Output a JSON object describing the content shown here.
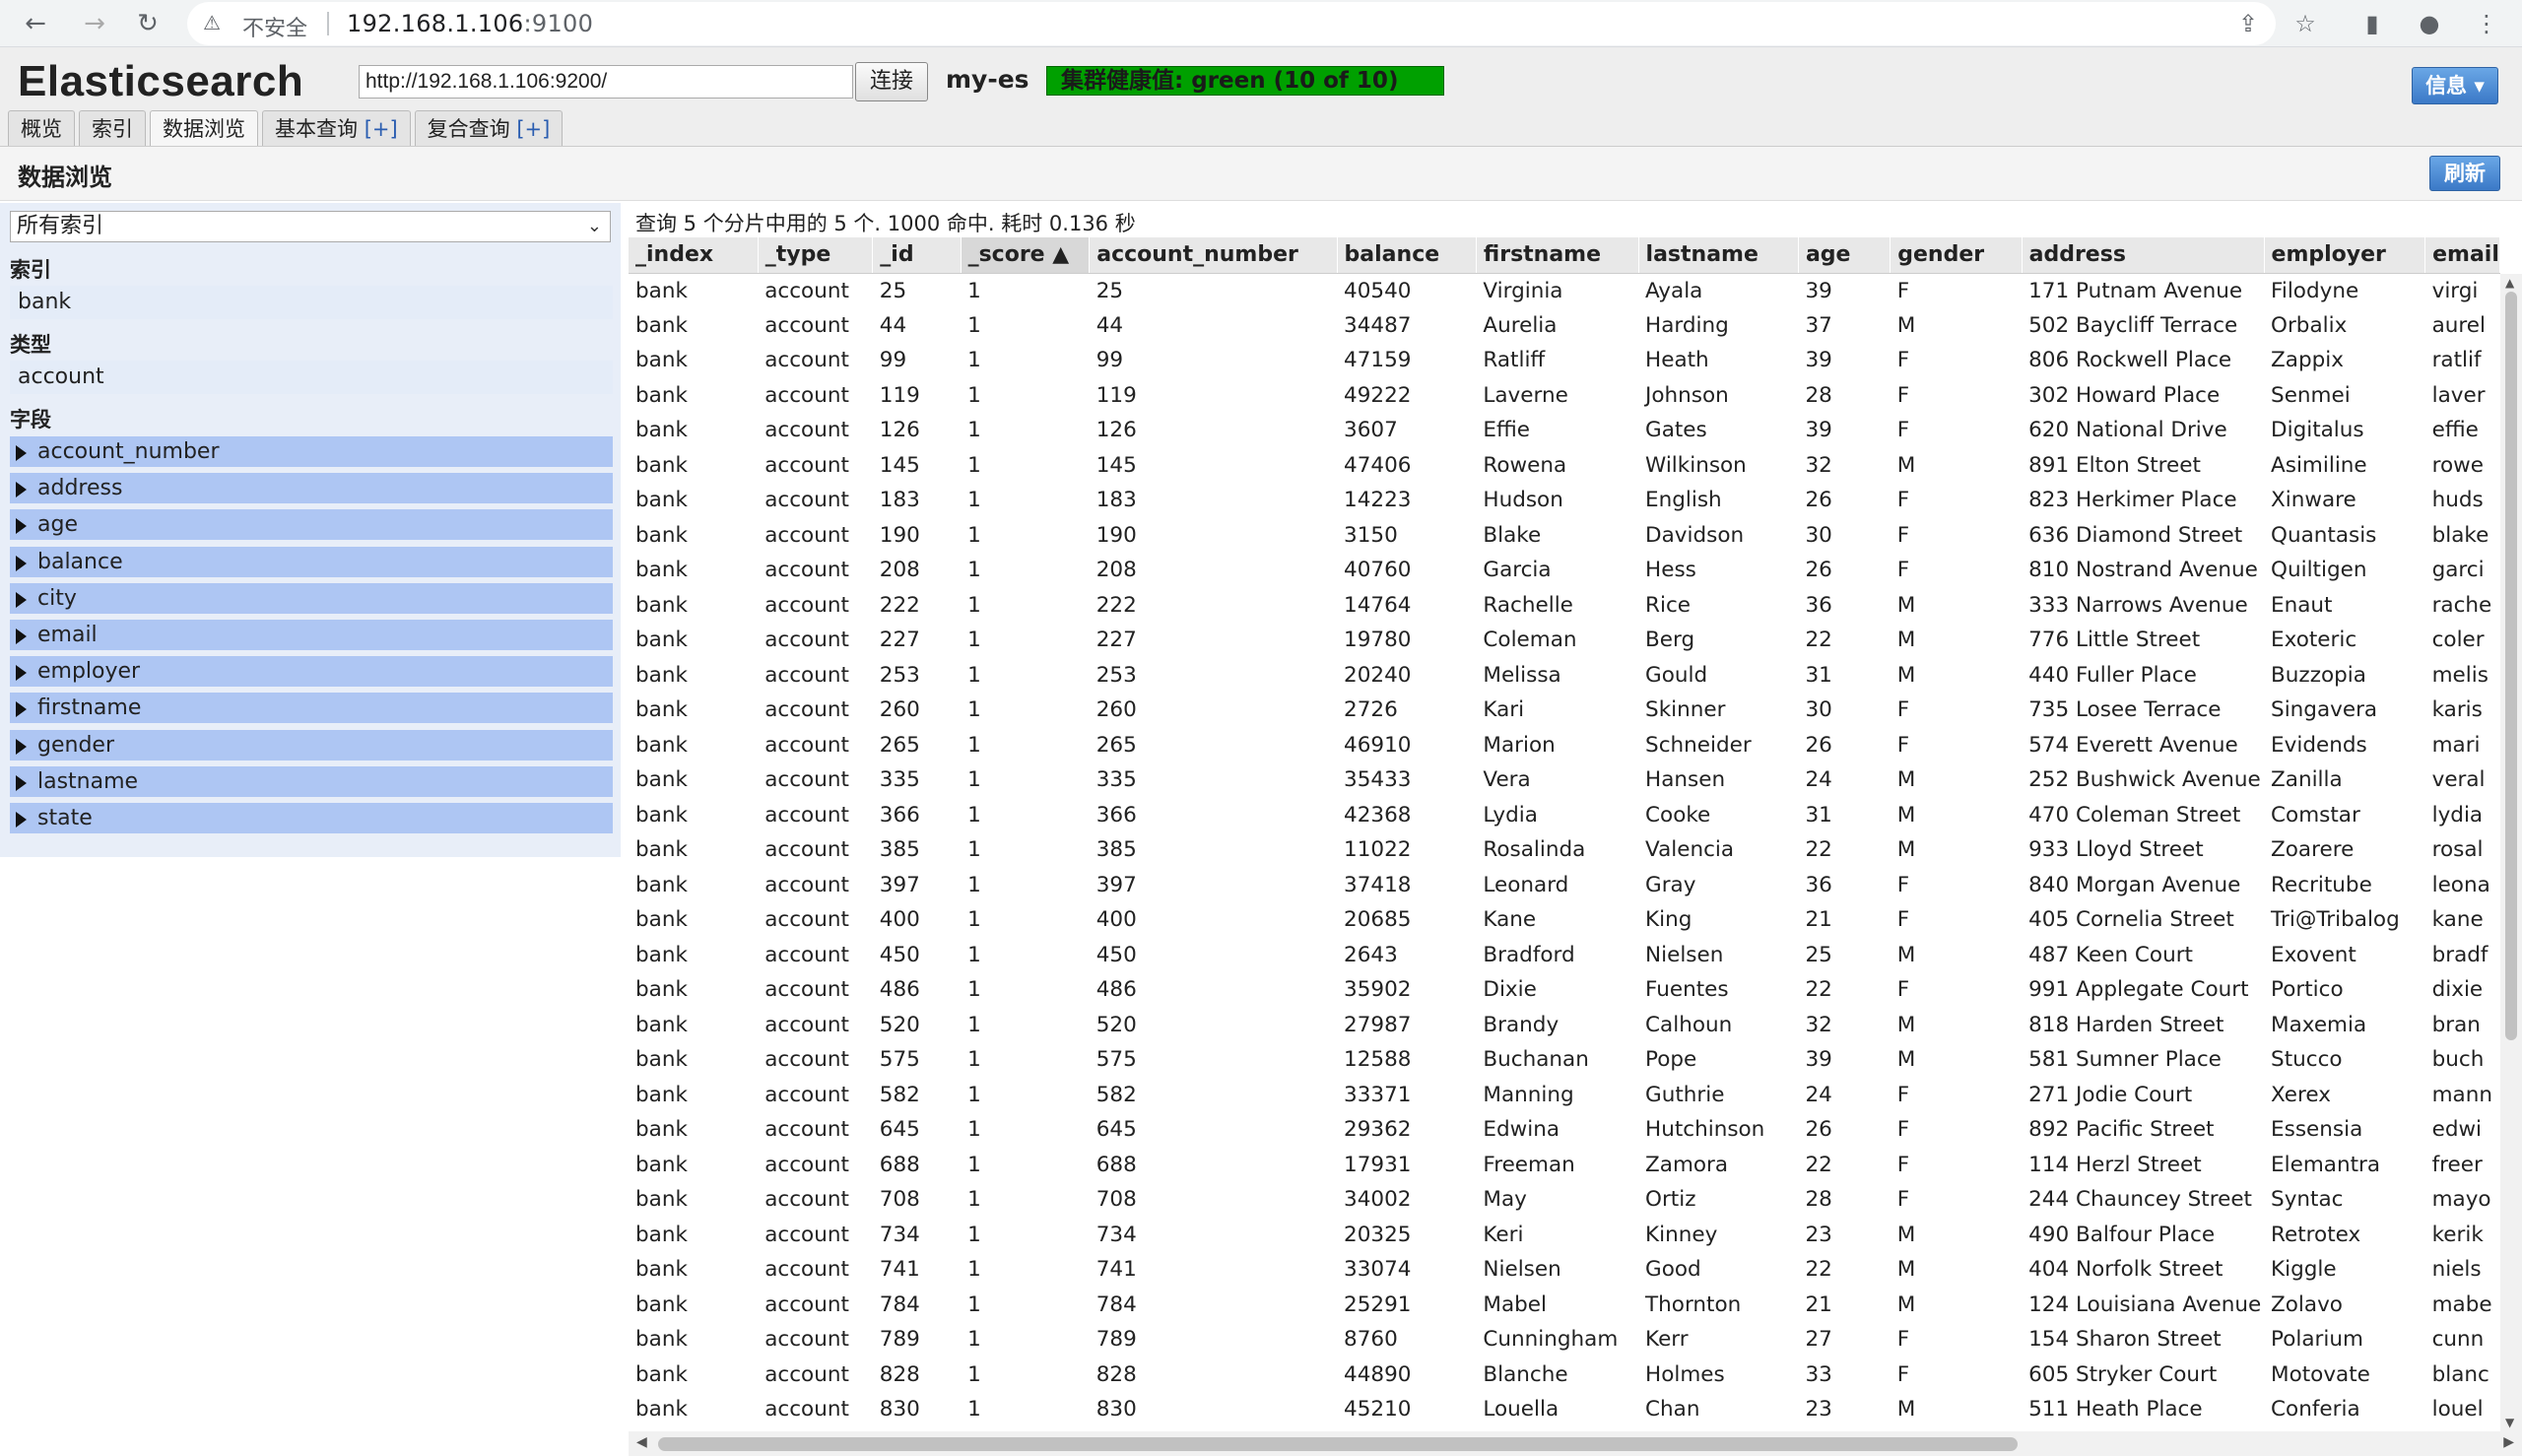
{
  "browser": {
    "warning_icon": "warning-triangle-icon",
    "insecure_label": "不安全",
    "url_host": "192.168.1.106",
    "url_port": ":9100"
  },
  "app": {
    "title": "Elasticsearch",
    "es_url": "http://192.168.1.106:9200/",
    "connect_label": "连接",
    "cluster_name": "my-es",
    "health_text": "集群健康值: green (10 of 10)",
    "info_label": "信息 ▾",
    "health_color": "#00a000"
  },
  "tabs": [
    {
      "label": "概览"
    },
    {
      "label": "索引"
    },
    {
      "label": "数据浏览"
    },
    {
      "label": "基本查询 ",
      "plus": "[+]"
    },
    {
      "label": "复合查询 ",
      "plus": "[+]"
    }
  ],
  "subheader": {
    "title": "数据浏览",
    "refresh_label": "刷新"
  },
  "sidebar": {
    "index_select_value": "所有索引",
    "index_label": "索引",
    "index_item": "bank",
    "type_label": "类型",
    "type_item": "account",
    "field_label": "字段",
    "fields": [
      "account_number",
      "address",
      "age",
      "balance",
      "city",
      "email",
      "employer",
      "firstname",
      "gender",
      "lastname",
      "state"
    ]
  },
  "results": {
    "summary": "查询 5 个分片中用的 5 个. 1000 命中. 耗时 0.136 秒",
    "columns": [
      "_index",
      "_type",
      "_id",
      "_score ▲",
      "account_number",
      "balance",
      "firstname",
      "lastname",
      "age",
      "gender",
      "address",
      "employer",
      "email"
    ],
    "rows": [
      [
        "bank",
        "account",
        "25",
        "1",
        "25",
        "40540",
        "Virginia",
        "Ayala",
        "39",
        "F",
        "171 Putnam Avenue",
        "Filodyne",
        "virgi"
      ],
      [
        "bank",
        "account",
        "44",
        "1",
        "44",
        "34487",
        "Aurelia",
        "Harding",
        "37",
        "M",
        "502 Baycliff Terrace",
        "Orbalix",
        "aurel"
      ],
      [
        "bank",
        "account",
        "99",
        "1",
        "99",
        "47159",
        "Ratliff",
        "Heath",
        "39",
        "F",
        "806 Rockwell Place",
        "Zappix",
        "ratlif"
      ],
      [
        "bank",
        "account",
        "119",
        "1",
        "119",
        "49222",
        "Laverne",
        "Johnson",
        "28",
        "F",
        "302 Howard Place",
        "Senmei",
        "laver"
      ],
      [
        "bank",
        "account",
        "126",
        "1",
        "126",
        "3607",
        "Effie",
        "Gates",
        "39",
        "F",
        "620 National Drive",
        "Digitalus",
        "effie"
      ],
      [
        "bank",
        "account",
        "145",
        "1",
        "145",
        "47406",
        "Rowena",
        "Wilkinson",
        "32",
        "M",
        "891 Elton Street",
        "Asimiline",
        "rowe"
      ],
      [
        "bank",
        "account",
        "183",
        "1",
        "183",
        "14223",
        "Hudson",
        "English",
        "26",
        "F",
        "823 Herkimer Place",
        "Xinware",
        "huds"
      ],
      [
        "bank",
        "account",
        "190",
        "1",
        "190",
        "3150",
        "Blake",
        "Davidson",
        "30",
        "F",
        "636 Diamond Street",
        "Quantasis",
        "blake"
      ],
      [
        "bank",
        "account",
        "208",
        "1",
        "208",
        "40760",
        "Garcia",
        "Hess",
        "26",
        "F",
        "810 Nostrand Avenue",
        "Quiltigen",
        "garci"
      ],
      [
        "bank",
        "account",
        "222",
        "1",
        "222",
        "14764",
        "Rachelle",
        "Rice",
        "36",
        "M",
        "333 Narrows Avenue",
        "Enaut",
        "rache"
      ],
      [
        "bank",
        "account",
        "227",
        "1",
        "227",
        "19780",
        "Coleman",
        "Berg",
        "22",
        "M",
        "776 Little Street",
        "Exoteric",
        "coler"
      ],
      [
        "bank",
        "account",
        "253",
        "1",
        "253",
        "20240",
        "Melissa",
        "Gould",
        "31",
        "M",
        "440 Fuller Place",
        "Buzzopia",
        "melis"
      ],
      [
        "bank",
        "account",
        "260",
        "1",
        "260",
        "2726",
        "Kari",
        "Skinner",
        "30",
        "F",
        "735 Losee Terrace",
        "Singavera",
        "karis"
      ],
      [
        "bank",
        "account",
        "265",
        "1",
        "265",
        "46910",
        "Marion",
        "Schneider",
        "26",
        "F",
        "574 Everett Avenue",
        "Evidends",
        "mari"
      ],
      [
        "bank",
        "account",
        "335",
        "1",
        "335",
        "35433",
        "Vera",
        "Hansen",
        "24",
        "M",
        "252 Bushwick Avenue",
        "Zanilla",
        "veral"
      ],
      [
        "bank",
        "account",
        "366",
        "1",
        "366",
        "42368",
        "Lydia",
        "Cooke",
        "31",
        "M",
        "470 Coleman Street",
        "Comstar",
        "lydia"
      ],
      [
        "bank",
        "account",
        "385",
        "1",
        "385",
        "11022",
        "Rosalinda",
        "Valencia",
        "22",
        "M",
        "933 Lloyd Street",
        "Zoarere",
        "rosal"
      ],
      [
        "bank",
        "account",
        "397",
        "1",
        "397",
        "37418",
        "Leonard",
        "Gray",
        "36",
        "F",
        "840 Morgan Avenue",
        "Recritube",
        "leona"
      ],
      [
        "bank",
        "account",
        "400",
        "1",
        "400",
        "20685",
        "Kane",
        "King",
        "21",
        "F",
        "405 Cornelia Street",
        "Tri@Tribalog",
        "kane"
      ],
      [
        "bank",
        "account",
        "450",
        "1",
        "450",
        "2643",
        "Bradford",
        "Nielsen",
        "25",
        "M",
        "487 Keen Court",
        "Exovent",
        "bradf"
      ],
      [
        "bank",
        "account",
        "486",
        "1",
        "486",
        "35902",
        "Dixie",
        "Fuentes",
        "22",
        "F",
        "991 Applegate Court",
        "Portico",
        "dixie"
      ],
      [
        "bank",
        "account",
        "520",
        "1",
        "520",
        "27987",
        "Brandy",
        "Calhoun",
        "32",
        "M",
        "818 Harden Street",
        "Maxemia",
        "bran"
      ],
      [
        "bank",
        "account",
        "575",
        "1",
        "575",
        "12588",
        "Buchanan",
        "Pope",
        "39",
        "M",
        "581 Sumner Place",
        "Stucco",
        "buch"
      ],
      [
        "bank",
        "account",
        "582",
        "1",
        "582",
        "33371",
        "Manning",
        "Guthrie",
        "24",
        "F",
        "271 Jodie Court",
        "Xerex",
        "mann"
      ],
      [
        "bank",
        "account",
        "645",
        "1",
        "645",
        "29362",
        "Edwina",
        "Hutchinson",
        "26",
        "F",
        "892 Pacific Street",
        "Essensia",
        "edwi"
      ],
      [
        "bank",
        "account",
        "688",
        "1",
        "688",
        "17931",
        "Freeman",
        "Zamora",
        "22",
        "F",
        "114 Herzl Street",
        "Elemantra",
        "freer"
      ],
      [
        "bank",
        "account",
        "708",
        "1",
        "708",
        "34002",
        "May",
        "Ortiz",
        "28",
        "F",
        "244 Chauncey Street",
        "Syntac",
        "mayo"
      ],
      [
        "bank",
        "account",
        "734",
        "1",
        "734",
        "20325",
        "Keri",
        "Kinney",
        "23",
        "M",
        "490 Balfour Place",
        "Retrotex",
        "kerik"
      ],
      [
        "bank",
        "account",
        "741",
        "1",
        "741",
        "33074",
        "Nielsen",
        "Good",
        "22",
        "M",
        "404 Norfolk Street",
        "Kiggle",
        "niels"
      ],
      [
        "bank",
        "account",
        "784",
        "1",
        "784",
        "25291",
        "Mabel",
        "Thornton",
        "21",
        "M",
        "124 Louisiana Avenue",
        "Zolavo",
        "mabe"
      ],
      [
        "bank",
        "account",
        "789",
        "1",
        "789",
        "8760",
        "Cunningham",
        "Kerr",
        "27",
        "F",
        "154 Sharon Street",
        "Polarium",
        "cunn"
      ],
      [
        "bank",
        "account",
        "828",
        "1",
        "828",
        "44890",
        "Blanche",
        "Holmes",
        "33",
        "F",
        "605 Stryker Court",
        "Motovate",
        "blanc"
      ],
      [
        "bank",
        "account",
        "830",
        "1",
        "830",
        "45210",
        "Louella",
        "Chan",
        "23",
        "M",
        "511 Heath Place",
        "Conferia",
        "louel"
      ]
    ]
  }
}
